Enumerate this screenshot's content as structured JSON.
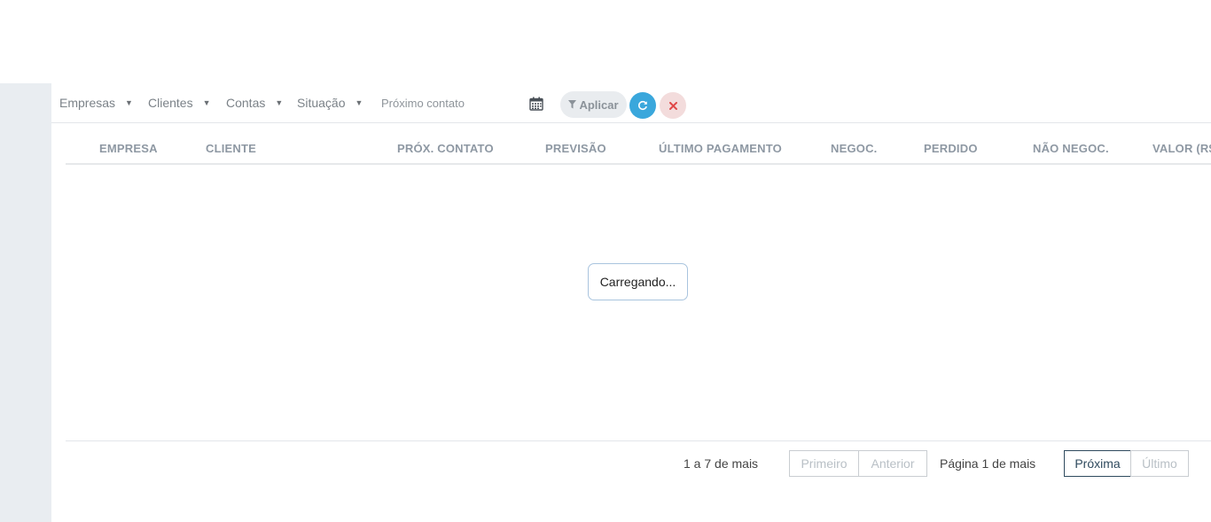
{
  "filters": {
    "empresas": "Empresas",
    "clientes": "Clientes",
    "contas": "Contas",
    "situacao": "Situação",
    "proximo_contato_placeholder": "Próximo contato",
    "apply_label": "Aplicar",
    "icons": {
      "calendar": "calendar-icon",
      "filter": "filter-icon",
      "refresh": "refresh-icon",
      "clear": "close-icon",
      "dropdown": "caret-down-icon"
    }
  },
  "table": {
    "columns": [
      "EMPRESA",
      "CLIENTE",
      "PRÓX. CONTATO",
      "PREVISÃO",
      "ÚLTIMO PAGAMENTO",
      "NEGOC.",
      "PERDIDO",
      "NÃO NEGOC.",
      "VALOR (R$"
    ],
    "loading_text": "Carregando..."
  },
  "pagination": {
    "range_text": "1 a 7 de mais",
    "first": "Primeiro",
    "previous": "Anterior",
    "page_text": "Página 1 de mais",
    "next": "Próxima",
    "last": "Último"
  },
  "colors": {
    "refresh_button": "#3aa7dc",
    "clear_button_bg": "#f3dcdc",
    "clear_icon": "#e04848",
    "sidebar_bg": "#e9edf1"
  }
}
